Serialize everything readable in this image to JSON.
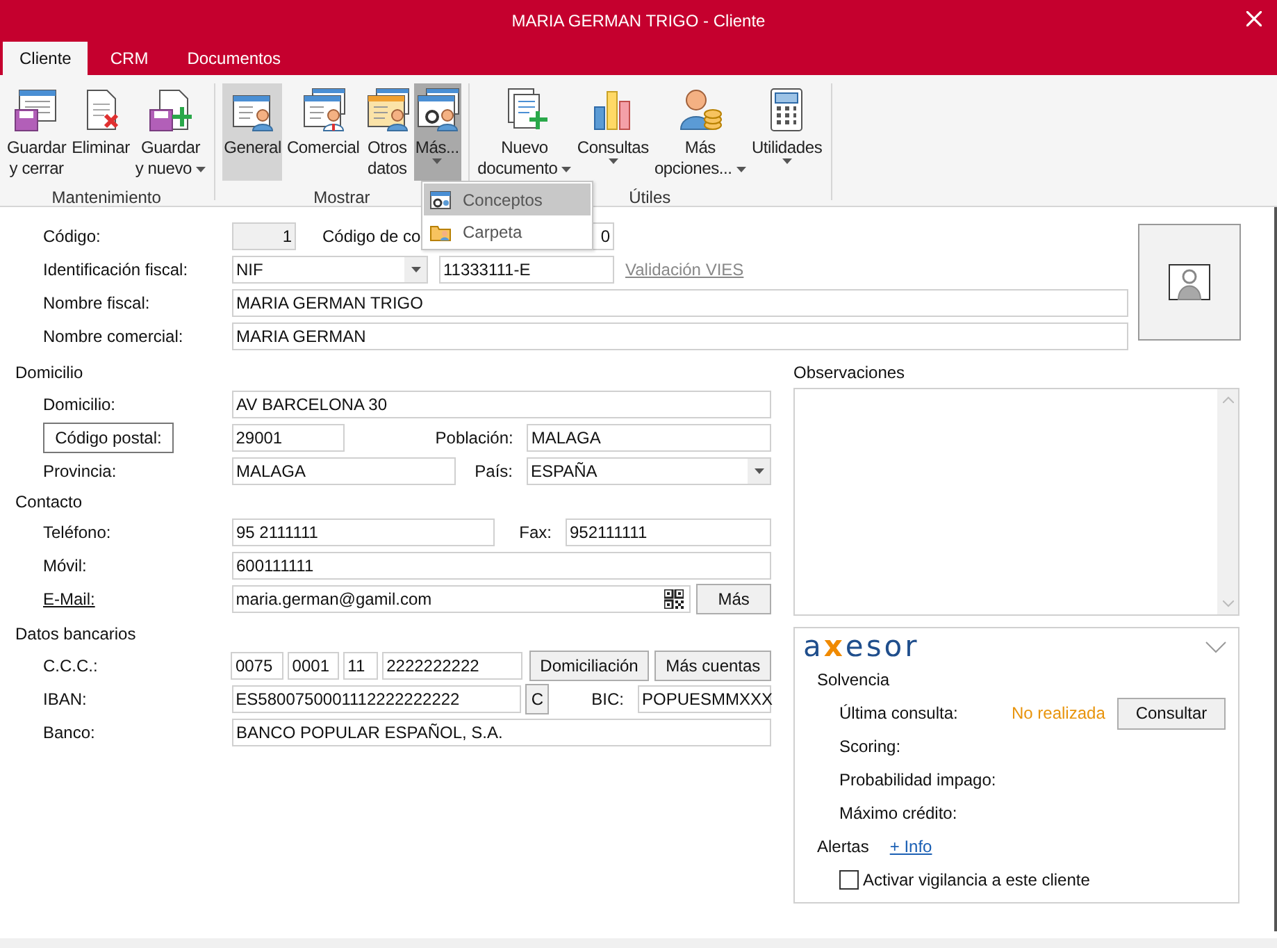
{
  "window": {
    "title": "MARIA GERMAN TRIGO - Cliente"
  },
  "tabs": [
    {
      "label": "Cliente",
      "selected": true
    },
    {
      "label": "CRM",
      "selected": false
    },
    {
      "label": "Documentos",
      "selected": false
    }
  ],
  "ribbon": {
    "groups": [
      {
        "label": "Mantenimiento",
        "buttons": [
          {
            "kind": "save",
            "lines": [
              "Guardar",
              "y cerrar"
            ],
            "dropdown": false
          },
          {
            "kind": "delete",
            "lines": [
              "Eliminar"
            ],
            "dropdown": false
          },
          {
            "kind": "savenew",
            "lines": [
              "Guardar",
              "y nuevo"
            ],
            "dropdown": true
          }
        ]
      },
      {
        "label": "Mostrar",
        "buttons": [
          {
            "kind": "general",
            "lines": [
              "General"
            ],
            "dropdown": false,
            "selected": true,
            "expanded": false
          },
          {
            "kind": "commercial",
            "lines": [
              "Comercial"
            ],
            "dropdown": false,
            "selected": false,
            "expanded": false
          },
          {
            "kind": "other",
            "lines": [
              "Otros",
              "datos"
            ],
            "dropdown": false,
            "selected": false,
            "expanded": false
          },
          {
            "kind": "more",
            "lines": [
              "Más..."
            ],
            "dropdown": true,
            "selected": false,
            "expanded": true
          }
        ]
      },
      {
        "label": "Útiles",
        "buttons": [
          {
            "kind": "document",
            "lines": [
              "Nuevo",
              "documento"
            ],
            "dropdown": true
          },
          {
            "kind": "chart",
            "lines": [
              "Consultas"
            ],
            "dropdown": true
          },
          {
            "kind": "coins",
            "lines": [
              "Más",
              "opciones..."
            ],
            "dropdown": true
          },
          {
            "kind": "calculator",
            "lines": [
              "Utilidades"
            ],
            "dropdown": true
          }
        ]
      }
    ]
  },
  "menu": {
    "items": [
      {
        "label": "Conceptos",
        "kind": "gear",
        "selected": true
      },
      {
        "label": "Carpeta",
        "kind": "folder",
        "selected": false
      }
    ]
  },
  "general": {
    "codigo": {
      "label": "Código:",
      "value": "1"
    },
    "codigo_contable": {
      "label": "Código de co",
      "value": "0"
    },
    "identificacion": {
      "label": "Identificación fiscal:",
      "type": "NIF",
      "value": "11333111-E",
      "link": "Validación VIES"
    },
    "nombre_fiscal": {
      "label": "Nombre fiscal:",
      "value": "MARIA GERMAN TRIGO"
    },
    "nombre_comercial": {
      "label": "Nombre comercial:",
      "value": "MARIA GERMAN"
    }
  },
  "domicilio": {
    "heading": "Domicilio",
    "domicilio": {
      "label": "Domicilio:",
      "value": "AV BARCELONA 30"
    },
    "codigo_postal": {
      "button": "Código postal:",
      "value": "29001"
    },
    "poblacion": {
      "label": "Población:",
      "value": "MALAGA"
    },
    "provincia": {
      "label": "Provincia:",
      "value": "MALAGA"
    },
    "pais": {
      "label": "País:",
      "value": "ESPAÑA"
    }
  },
  "contacto": {
    "heading": "Contacto",
    "telefono": {
      "label": "Teléfono:",
      "value": "95 2111111"
    },
    "fax": {
      "label": "Fax:",
      "value": "952111111"
    },
    "movil": {
      "label": "Móvil:",
      "value": "600111111"
    },
    "email": {
      "label": "E-Mail:",
      "value": "maria.german@gamil.com",
      "button": "Más"
    }
  },
  "datos_bancarios": {
    "heading": "Datos bancarios",
    "ccc": {
      "label": "C.C.C.:",
      "parts": [
        "0075",
        "0001",
        "11",
        "2222222222"
      ],
      "buttons": [
        "Domiciliación",
        "Más cuentas"
      ]
    },
    "iban": {
      "label": "IBAN:",
      "value": "ES5800750001112222222222",
      "button": "C"
    },
    "bic": {
      "label": "BIC:",
      "value": "POPUESMMXXX"
    },
    "banco": {
      "label": "Banco:",
      "value": "BANCO POPULAR ESPAÑOL, S.A."
    }
  },
  "observaciones": {
    "label": "Observaciones"
  },
  "axesor": {
    "logo": "axesor",
    "solvencia": "Solvencia",
    "rows": [
      {
        "label": "Última consulta:",
        "value": "No realizada"
      },
      {
        "label": "Scoring:"
      },
      {
        "label": "Probabilidad impago:"
      },
      {
        "label": "Máximo crédito:"
      }
    ],
    "consultar": "Consultar",
    "alertas": "Alertas",
    "info_link": "+ Info",
    "vigilancia": {
      "label": "Activar vigilancia a este cliente",
      "checked": false
    }
  }
}
